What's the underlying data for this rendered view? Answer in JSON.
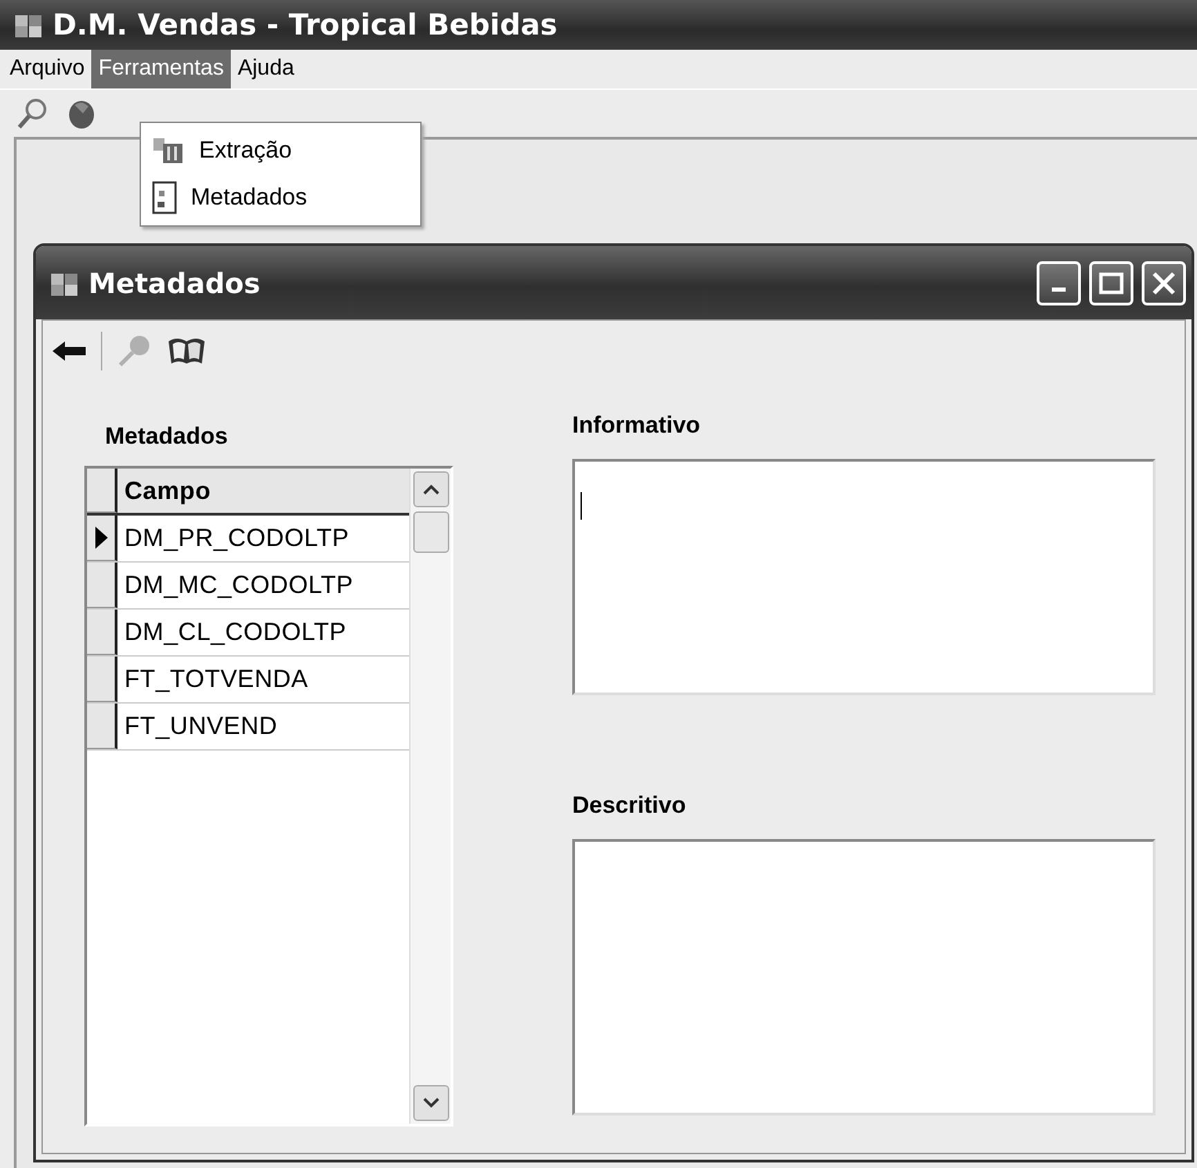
{
  "window": {
    "title": "D.M. Vendas - Tropical Bebidas"
  },
  "menu_bar": [
    {
      "label": "Arquivo",
      "selected": false
    },
    {
      "label": "Ferramentas",
      "selected": true
    },
    {
      "label": "Ajuda",
      "selected": false
    }
  ],
  "open_menu": {
    "items": [
      {
        "label": "Extração",
        "kind": "extract"
      },
      {
        "label": "Metadados",
        "kind": "document"
      }
    ]
  },
  "child_window": {
    "title": "Metadados",
    "toolbar": [
      {
        "kind": "back",
        "disabled": false
      },
      {
        "kind": "key",
        "disabled": true
      },
      {
        "kind": "book",
        "disabled": false
      }
    ],
    "metadados": {
      "label": "Metadados",
      "columns": [
        "Campo"
      ],
      "rows": [
        {
          "campo": "DM_PR_CODOLTP",
          "selected": true
        },
        {
          "campo": "DM_MC_CODOLTP",
          "selected": false
        },
        {
          "campo": "DM_CL_CODOLTP",
          "selected": false
        },
        {
          "campo": "FT_TOTVENDA",
          "selected": false
        },
        {
          "campo": "FT_UNVEND",
          "selected": false
        }
      ]
    },
    "informativo": {
      "label": "Informativo",
      "focused": true
    },
    "descritivo": {
      "label": "Descritivo",
      "focused": false
    }
  }
}
